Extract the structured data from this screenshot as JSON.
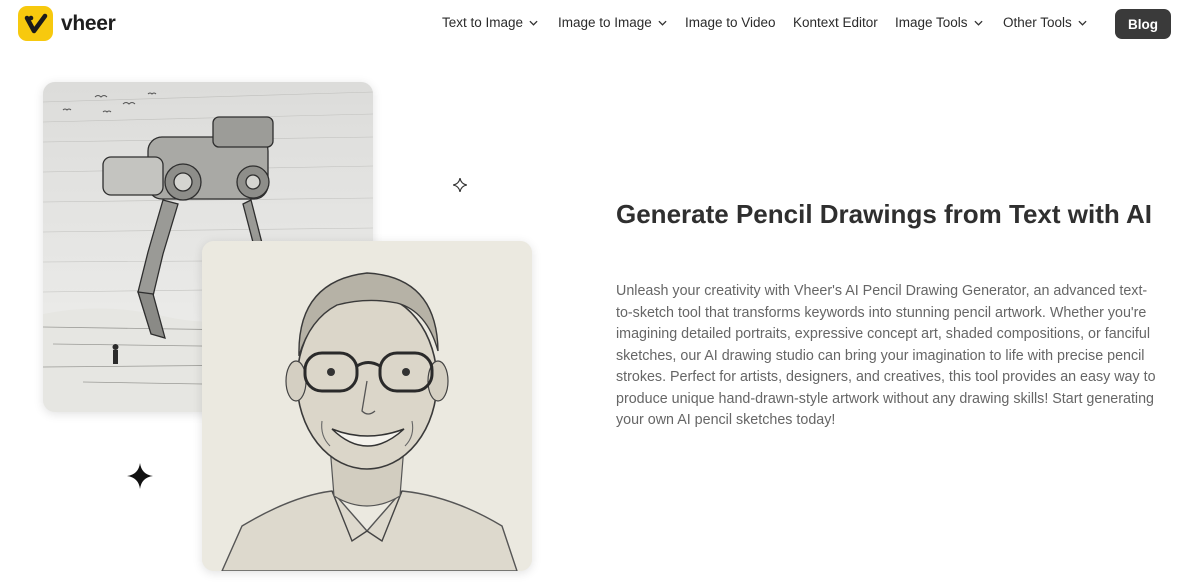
{
  "brand": {
    "name": "vheer",
    "logo_color": "#f7c90e"
  },
  "nav": {
    "items": [
      {
        "label": "Text to Image",
        "has_dropdown": true
      },
      {
        "label": "Image to Image",
        "has_dropdown": true
      },
      {
        "label": "Image to Video",
        "has_dropdown": false
      },
      {
        "label": "Kontext Editor",
        "has_dropdown": false
      },
      {
        "label": "Image Tools",
        "has_dropdown": true
      },
      {
        "label": "Other Tools",
        "has_dropdown": true
      }
    ],
    "blog_label": "Blog"
  },
  "hero": {
    "title": "Generate Pencil Drawings from Text with AI",
    "description": "Unleash your creativity with Vheer's AI Pencil Drawing Generator, an advanced text-to-sketch tool that transforms keywords into stunning pencil artwork. Whether you're imagining detailed portraits, expressive concept art, shaded compositions, or fanciful sketches, our AI drawing studio can bring your imagination to life with precise pencil strokes. Perfect for artists, designers, and creatives, this tool provides an easy way to produce unique hand-drawn-style artwork without any drawing skills! Start generating your own AI pencil sketches today!"
  },
  "icons": {
    "logo": "v-checkmark-icon",
    "chevron": "chevron-down-icon",
    "sparkle": "four-point-star-icon"
  }
}
